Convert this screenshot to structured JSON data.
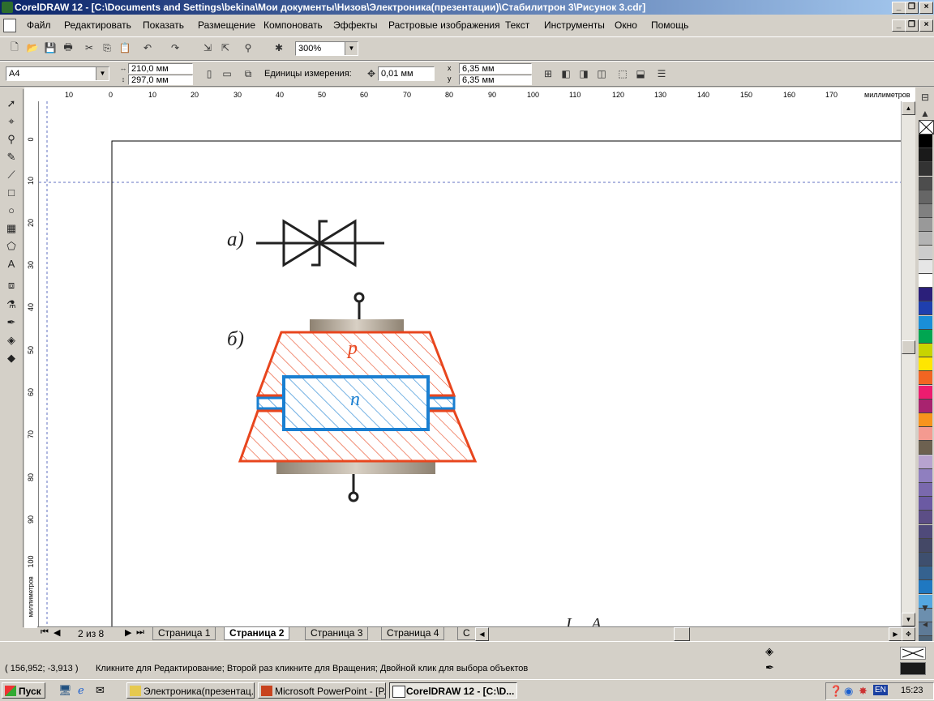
{
  "window": {
    "title": "CorelDRAW 12 - [C:\\Documents and Settings\\bekina\\Мои документы\\Низов\\Электроника(презентации)\\Стабилитрон 3\\Рисунок 3.cdr]"
  },
  "menu": [
    "Файл",
    "Редактировать",
    "Показать",
    "Размещение",
    "Компоновать",
    "Эффекты",
    "Растровые изображения",
    "Текст",
    "Инструменты",
    "Окно",
    "Помощь"
  ],
  "toolbar": {
    "zoom": "300%"
  },
  "propertybar": {
    "page_size": "A4",
    "width": "210,0 мм",
    "height": "297,0 мм",
    "units_label": "Единицы измерения:",
    "nudge": "0,01 мм",
    "dup_x_label": "x",
    "dup_x": "6,35 мм",
    "dup_y_label": "y",
    "dup_y": "6,35 мм"
  },
  "ruler": {
    "units": "миллиметров",
    "h_ticks": [
      "10",
      "0",
      "10",
      "20",
      "30",
      "40",
      "50",
      "60",
      "70",
      "80",
      "90",
      "100",
      "110",
      "120",
      "130",
      "140",
      "150",
      "160",
      "170"
    ],
    "v_ticks": [
      "0",
      "10",
      "20",
      "30",
      "40",
      "50",
      "60",
      "70",
      "80",
      "90",
      "100"
    ],
    "v_units": "миллиметров"
  },
  "drawing": {
    "label_a": "а)",
    "label_b": "б)",
    "label_p": "p",
    "label_n": "n",
    "partial_text": "I ... A",
    "colors": {
      "p_region": "#e8461e",
      "n_region": "#1a7fd1",
      "contact": "#a89c8c",
      "line": "#222222"
    }
  },
  "pages": {
    "counter": "2 из 8",
    "tabs": [
      "Страница 1",
      "Страница 2",
      "Страница 3",
      "Страница 4",
      "С"
    ],
    "active": "Страница 2"
  },
  "status": {
    "coords": "( 156,952; -3,913 )",
    "hint": "Кликните для Редактирование; Второй раз кликните для Вращения; Двойной клик для выбора объектов"
  },
  "taskbar": {
    "start": "Пуск",
    "items": [
      "Электроника(презентац...",
      "Microsoft PowerPoint - [P...",
      "CorelDRAW 12 - [C:\\D..."
    ],
    "lang": "EN",
    "clock": "15:23"
  },
  "palette": [
    "#ffffff",
    "#000000",
    "#1a1a1a",
    "#333333",
    "#4d4d4d",
    "#666666",
    "#808080",
    "#999999",
    "#b3b3b3",
    "#cccccc",
    "#e6e6e6",
    "#ffffff",
    "#2b1f7a",
    "#1f3fae",
    "#1a8fd8",
    "#00a651",
    "#c8d400",
    "#ffe600",
    "#f26522",
    "#ed1c6f",
    "#a8236f",
    "#f7941d",
    "#f49a90",
    "#6d6150",
    "#b7a3cf",
    "#8f7fbf",
    "#7a69ad",
    "#6b5aa3",
    "#5c4e86",
    "#4f4a7a",
    "#444866",
    "#3e4f6e",
    "#35628f",
    "#1f78c1",
    "#54a7e0",
    "#6c8fae",
    "#5e7a96",
    "#4f6578"
  ]
}
